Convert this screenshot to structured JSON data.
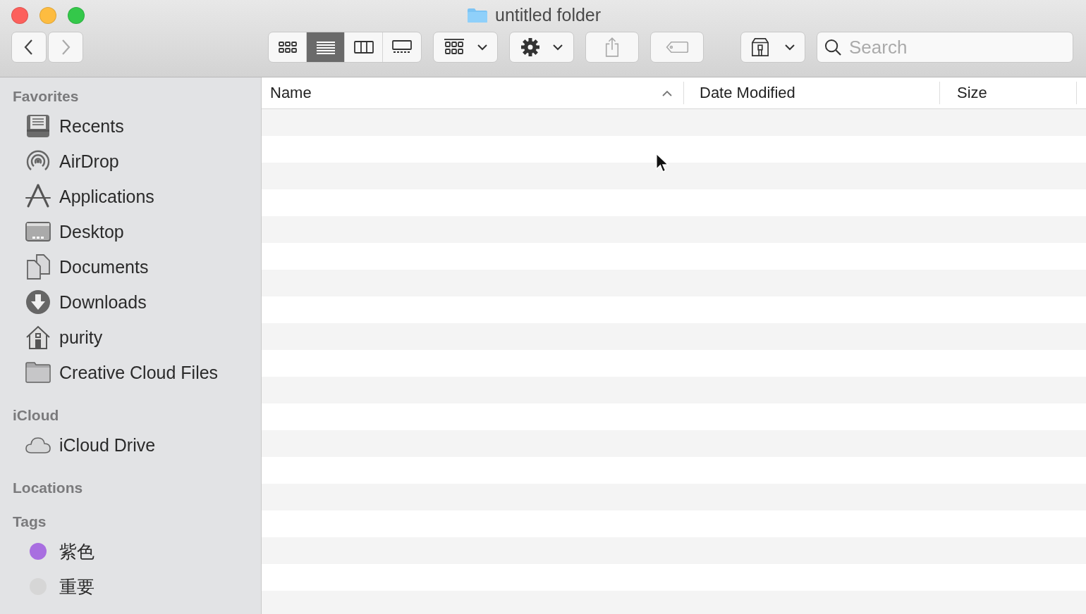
{
  "window": {
    "title": "untitled folder"
  },
  "navigation": [
    {
      "kind": "back",
      "disabled": false
    },
    {
      "kind": "forward",
      "disabled": true
    }
  ],
  "view_modes": [
    {
      "selected": false
    },
    {
      "selected": true
    },
    {
      "selected": false
    },
    {
      "selected": false
    }
  ],
  "search": {
    "placeholder": "Search"
  },
  "columns": [
    {
      "label": "Name",
      "sorted": true
    },
    {
      "label": "Date Modified",
      "sorted": false
    },
    {
      "label": "Size",
      "sorted": false
    }
  ],
  "sidebar": {
    "sections": [
      {
        "title": "Favorites",
        "items": [
          {
            "kind": "place",
            "label": "Recents"
          },
          {
            "kind": "place",
            "label": "AirDrop"
          },
          {
            "kind": "place",
            "label": "Applications"
          },
          {
            "kind": "place",
            "label": "Desktop"
          },
          {
            "kind": "place",
            "label": "Documents"
          },
          {
            "kind": "place",
            "label": "Downloads"
          },
          {
            "kind": "place",
            "label": "purity"
          },
          {
            "kind": "place",
            "label": "Creative Cloud Files"
          }
        ]
      },
      {
        "title": "iCloud",
        "items": [
          {
            "kind": "cloud",
            "label": "iCloud Drive"
          }
        ]
      },
      {
        "title": "Locations"
      },
      {
        "title": "Tags",
        "items": [
          {
            "kind": "tag",
            "label": "紫色",
            "color": "#a86ee0"
          },
          {
            "kind": "tag",
            "label": "重要",
            "color": "#d6d6d6"
          }
        ]
      }
    ]
  }
}
